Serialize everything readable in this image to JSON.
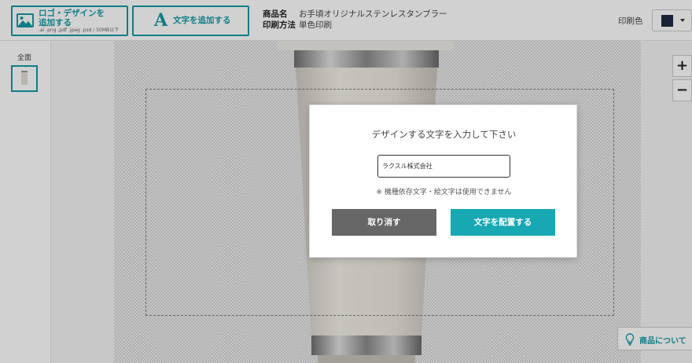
{
  "toolbar": {
    "logo_button": {
      "line1": "ロゴ・デザインを",
      "line2": "追加する",
      "formats": ".ai .png .pdf .jpeg .psd / 50MB以下",
      "icon": "image-icon"
    },
    "text_button": {
      "glyph": "A",
      "label": "文字を追加する"
    },
    "product": {
      "name_label": "商品名",
      "name_value": "お手頃オリジナルステンレスタンブラー",
      "method_label": "印刷方法",
      "method_value": "単色印刷"
    },
    "print_color": {
      "label": "印刷色",
      "value_color": "#1f2a44"
    }
  },
  "sidebar": {
    "face_label": "全面"
  },
  "canvas": {
    "zoom_in": "+",
    "zoom_out": "−",
    "about_button": "商品について"
  },
  "modal": {
    "title": "デザインする文字を入力して下さい",
    "input_value": "ラクスル株式会社",
    "note": "※ 機種依存文字・絵文字は使用できません",
    "cancel_label": "取り消す",
    "confirm_label": "文字を配置する"
  },
  "colors": {
    "accent": "#159aa5",
    "cancel": "#676767",
    "confirm": "#17a8b4"
  }
}
